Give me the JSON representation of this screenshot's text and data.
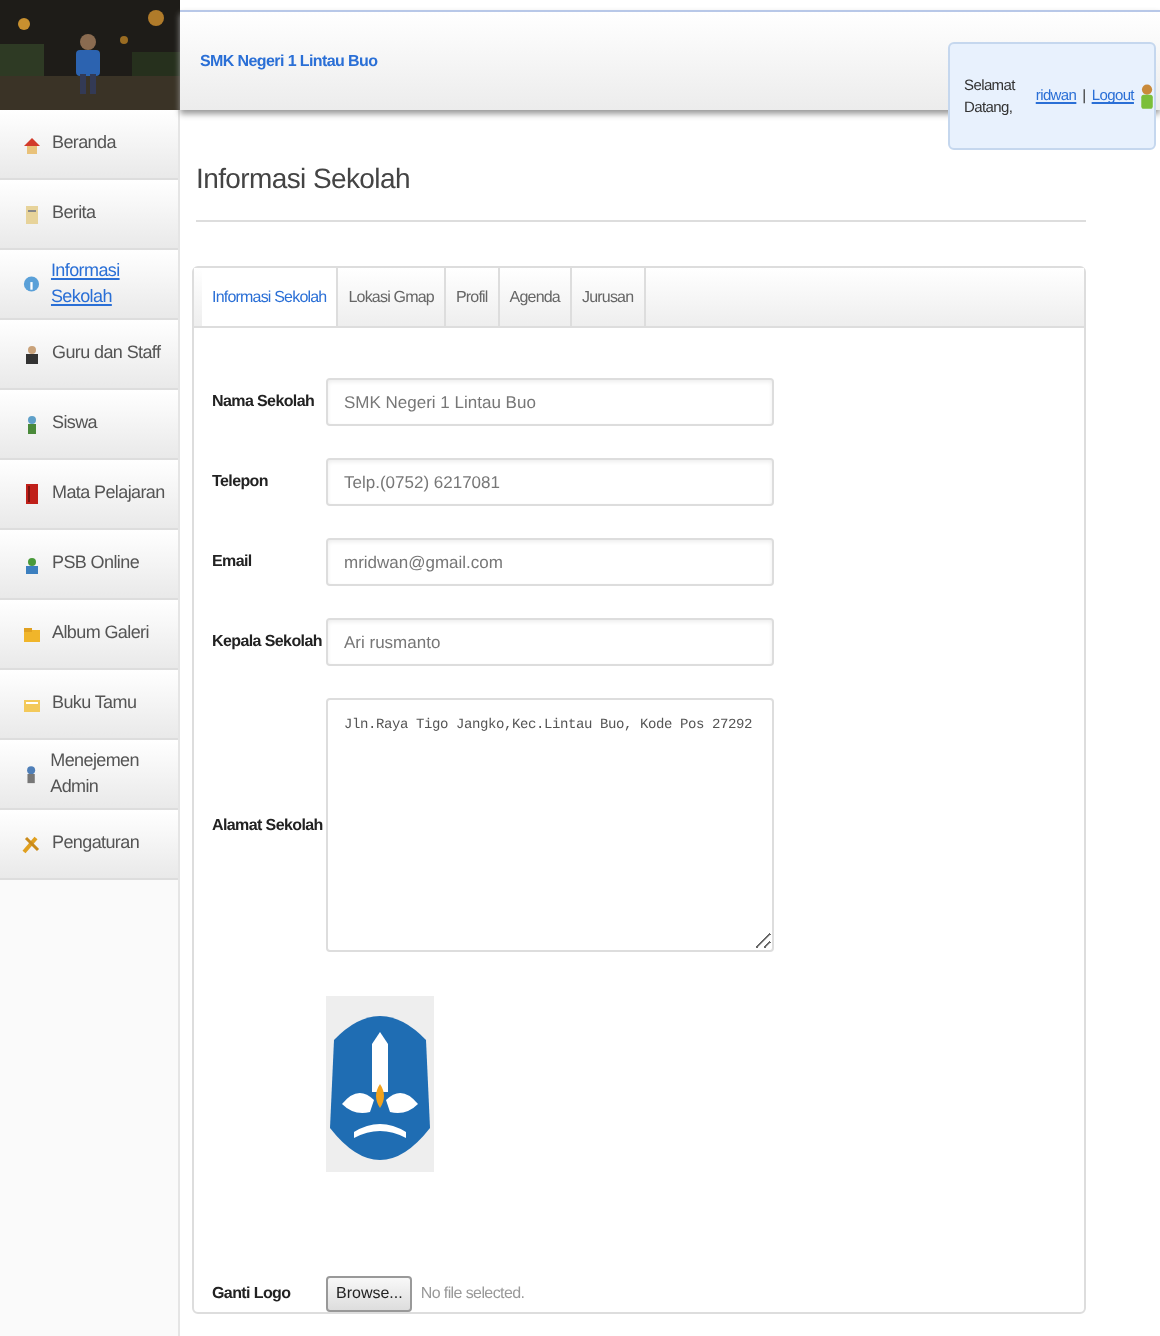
{
  "header": {
    "site_title": "SMK Negeri 1 Lintau Buo",
    "welcome": {
      "text": "Selamat Datang,",
      "user": "ridwan",
      "separator": "|",
      "logout": "Logout"
    }
  },
  "sidebar": {
    "items": [
      {
        "label": "Beranda",
        "selected": false
      },
      {
        "label": "Berita",
        "selected": false
      },
      {
        "label": "Informasi Sekolah",
        "selected": true
      },
      {
        "label": "Guru dan Staff",
        "selected": false
      },
      {
        "label": "Siswa",
        "selected": false
      },
      {
        "label": "Mata Pelajaran",
        "selected": false
      },
      {
        "label": "PSB Online",
        "selected": false
      },
      {
        "label": "Album Galeri",
        "selected": false
      },
      {
        "label": "Buku Tamu",
        "selected": false
      },
      {
        "label": "Menejemen Admin",
        "selected": false
      },
      {
        "label": "Pengaturan",
        "selected": false
      }
    ]
  },
  "page_title": "Informasi Sekolah",
  "tabs": [
    {
      "label": "Informasi Sekolah",
      "selected": true
    },
    {
      "label": "Lokasi Gmap",
      "selected": false
    },
    {
      "label": "Profil",
      "selected": false
    },
    {
      "label": "Agenda",
      "selected": false
    },
    {
      "label": "Jurusan",
      "selected": false
    }
  ],
  "form": {
    "fields": [
      {
        "kind": "text",
        "label": "Nama Sekolah",
        "value": "SMK Negeri 1 Lintau Buo"
      },
      {
        "kind": "text",
        "label": "Telepon",
        "value": "Telp.(0752) 6217081"
      },
      {
        "kind": "text",
        "label": "Email",
        "value": "mridwan@gmail.com"
      },
      {
        "kind": "text",
        "label": "Kepala Sekolah",
        "value": "Ari rusmanto"
      },
      {
        "kind": "textarea",
        "label": "Alamat Sekolah",
        "value": "Jln.Raya Tigo Jangko,Kec.Lintau Buo, Kode Pos 27292"
      },
      {
        "kind": "logo"
      },
      {
        "kind": "file",
        "label": "Ganti Logo",
        "button": "Browse...",
        "status": "No file selected."
      }
    ]
  }
}
